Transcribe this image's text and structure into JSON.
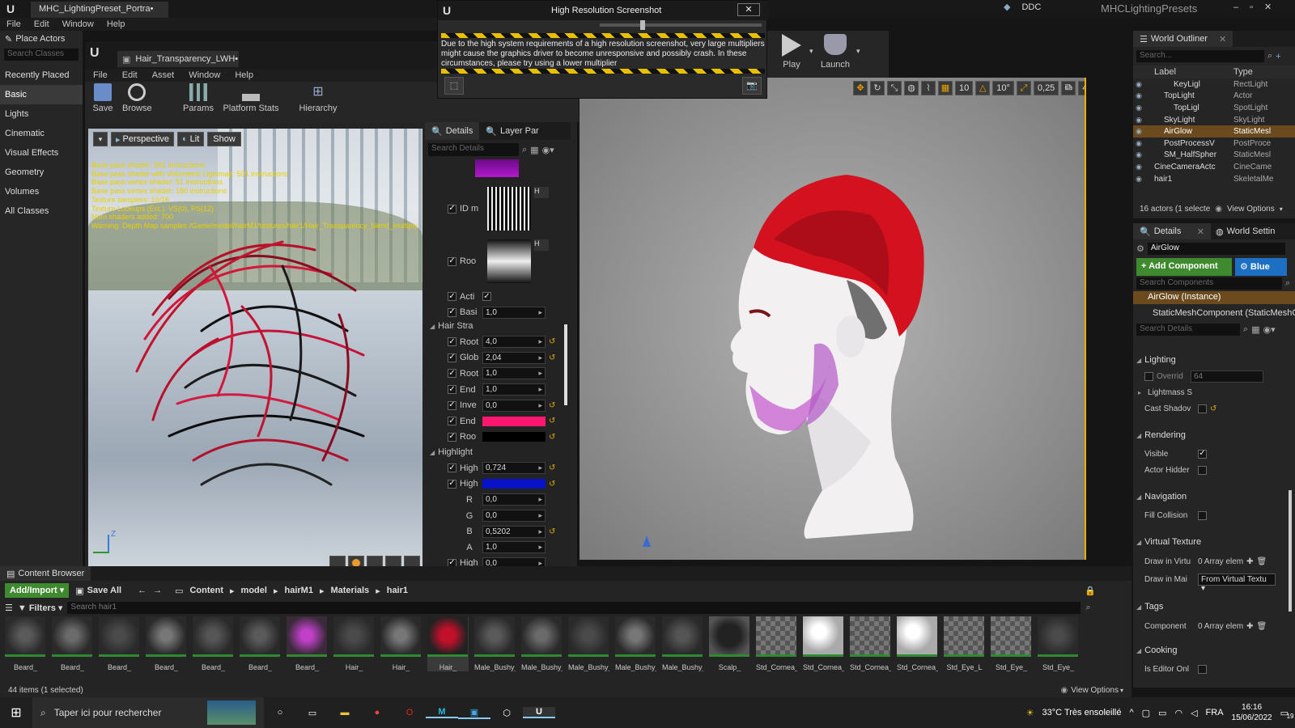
{
  "titlebar": {
    "project_tab": "MHC_LightingPreset_Portra•",
    "ddc": "DDC",
    "app_name": "MHCLightingPresets"
  },
  "main_menu": [
    "File",
    "Edit",
    "Window",
    "Help"
  ],
  "place_actors": {
    "title": "Place Actors",
    "search_placeholder": "Search Classes",
    "categories": [
      "Recently Placed",
      "Basic",
      "Lights",
      "Cinematic",
      "Visual Effects",
      "Geometry",
      "Volumes",
      "All Classes"
    ]
  },
  "material_editor": {
    "tab": "Hair_Transparency_LWH•",
    "menu": [
      "File",
      "Edit",
      "Asset",
      "Window",
      "Help"
    ],
    "toolbar": [
      "Save",
      "Browse",
      "Params",
      "Platform Stats",
      "Hierarchy"
    ],
    "viewport": {
      "perspective": "Perspective",
      "lit": "Lit",
      "show": "Show",
      "stats": [
        "Base pass shader: 391 instructions",
        "Base pass shader with Volumetric Lightmap: 591 instructions",
        "Base pass vertex shader: 51 instructions",
        "Base pass vertex shader: 180 instructions",
        "Texture samplers: 10/16",
        "Texture Lookups (Est.): VS(0), PS(12)",
        "Num shaders added: 700",
        "Warning: Depth Map samples /Game/model/hairM1/textures/hair1/Hair_Transparency_blend_multiply"
      ],
      "axis_z": "Z"
    }
  },
  "details_panel": {
    "tabs": [
      "Details",
      "Layer Par"
    ],
    "search_placeholder": "Search Details",
    "tex_rows": [
      {
        "label": "ID m",
        "sel": "H"
      },
      {
        "label": "Roo",
        "sel": "H"
      }
    ],
    "rows1": [
      {
        "label": "Acti",
        "type": "check"
      },
      {
        "label": "Basi",
        "value": "1,0"
      }
    ],
    "group1": "Hair Stra",
    "rows2": [
      {
        "label": "Root",
        "value": "4,0"
      },
      {
        "label": "Glob",
        "value": "2,04"
      },
      {
        "label": "Root",
        "value": "1,0"
      },
      {
        "label": "End",
        "value": "1,0"
      },
      {
        "label": "Inve",
        "value": "0,0"
      },
      {
        "label": "End",
        "color": "#ff1870"
      },
      {
        "label": "Roo",
        "color": "#000000"
      }
    ],
    "group2": "Highlight",
    "rows3": [
      {
        "label": "High",
        "value": "0,724"
      },
      {
        "label": "High",
        "color": "#0a12c8"
      },
      {
        "label": "R",
        "value": "0,0"
      },
      {
        "label": "G",
        "value": "0,0"
      },
      {
        "label": "B",
        "value": "0,5202"
      },
      {
        "label": "A",
        "value": "1,0"
      },
      {
        "label": "High",
        "value": "0,0"
      }
    ]
  },
  "screenshot_dialog": {
    "title": "High Resolution Screenshot",
    "warning": "Due to the high system requirements of a high resolution screenshot, very large multipliers might cause the graphics driver to become unresponsive and possibly crash. In these circumstances, please try using a lower multiplier"
  },
  "level_toolbar": {
    "play": "Play",
    "launch": "Launch",
    "snap": "10",
    "angle": "10°",
    "scale": "0,25",
    "cam": "4"
  },
  "outliner": {
    "title": "World Outliner",
    "search_placeholder": "Search...",
    "col_label": "Label",
    "col_type": "Type",
    "rows": [
      {
        "label": "KeyLigl",
        "type": "RectLight",
        "indent": 3
      },
      {
        "label": "TopLight",
        "type": "Actor",
        "indent": 2
      },
      {
        "label": "TopLigl",
        "type": "SpotLight",
        "indent": 3
      },
      {
        "label": "SkyLight",
        "type": "SkyLight",
        "indent": 2
      },
      {
        "label": "AirGlow",
        "type": "StaticMesl",
        "indent": 2,
        "selected": true
      },
      {
        "label": "PostProcessV",
        "type": "PostProce",
        "indent": 2
      },
      {
        "label": "SM_HalfSpher",
        "type": "StaticMesl",
        "indent": 2
      },
      {
        "label": "CineCameraActc",
        "type": "CineCame",
        "indent": 1
      },
      {
        "label": "hair1",
        "type": "SkeletalMe",
        "indent": 1
      }
    ],
    "count": "16 actors (1 selecte",
    "view_options": "View Options"
  },
  "right_details": {
    "tabs": [
      "Details",
      "World Settin"
    ],
    "name": "AirGlow",
    "add_component": "+ Add Component",
    "blueprint": "Blue",
    "search_components": "Search Components",
    "instance": "AirGlow (Instance)",
    "component": "StaticMeshComponent (StaticMeshC",
    "search_details": "Search Details",
    "lighting": "Lighting",
    "override": "Overrid",
    "override_val": "64",
    "lightmass": "Lightmass S",
    "cast_shadow": "Cast Shadov",
    "rendering": "Rendering",
    "visible": "Visible",
    "actor_hidden": "Actor Hidder",
    "navigation": "Navigation",
    "fill_collision": "Fill Collision",
    "virtual_texture": "Virtual Texture",
    "draw_virt": "Draw in Virtu",
    "array_elems": "0 Array elem",
    "draw_main": "Draw in Mai",
    "from_vt": "From Virtual Textu",
    "tags": "Tags",
    "component_tags": "Component",
    "array_elems2": "0 Array elem",
    "cooking": "Cooking",
    "is_editor_only": "Is Editor Onl"
  },
  "content_browser": {
    "title": "Content Browser",
    "add_import": "Add/Import",
    "save_all": "Save All",
    "path": [
      "Content",
      "model",
      "hairM1",
      "Materials",
      "hair1"
    ],
    "filters": "Filters",
    "search_placeholder": "Search hair1",
    "assets": [
      "Beard_",
      "Beard_",
      "Beard_",
      "Beard_",
      "Beard_",
      "Beard_",
      "Beard_",
      "Hair_",
      "Hair_",
      "Hair_",
      "Male_Bushy_",
      "Male_Bushy_",
      "Male_Bushy_",
      "Male_Bushy_",
      "Male_Bushy_",
      "Scalp_",
      "Std_Cornea_L",
      "Std_Cornea_L",
      "Std_Cornea_R",
      "Std_Cornea_R",
      "Std_Eye_L",
      "Std_Eye_",
      "Std_Eye_"
    ],
    "count": "44 items (1 selected)",
    "view_options": "View Options"
  },
  "taskbar": {
    "search": "Taper ici pour rechercher",
    "weather": "33°C  Très ensoleillé",
    "lang": "FRA",
    "time": "16:16",
    "date": "15/06/2022",
    "notif": "19"
  }
}
